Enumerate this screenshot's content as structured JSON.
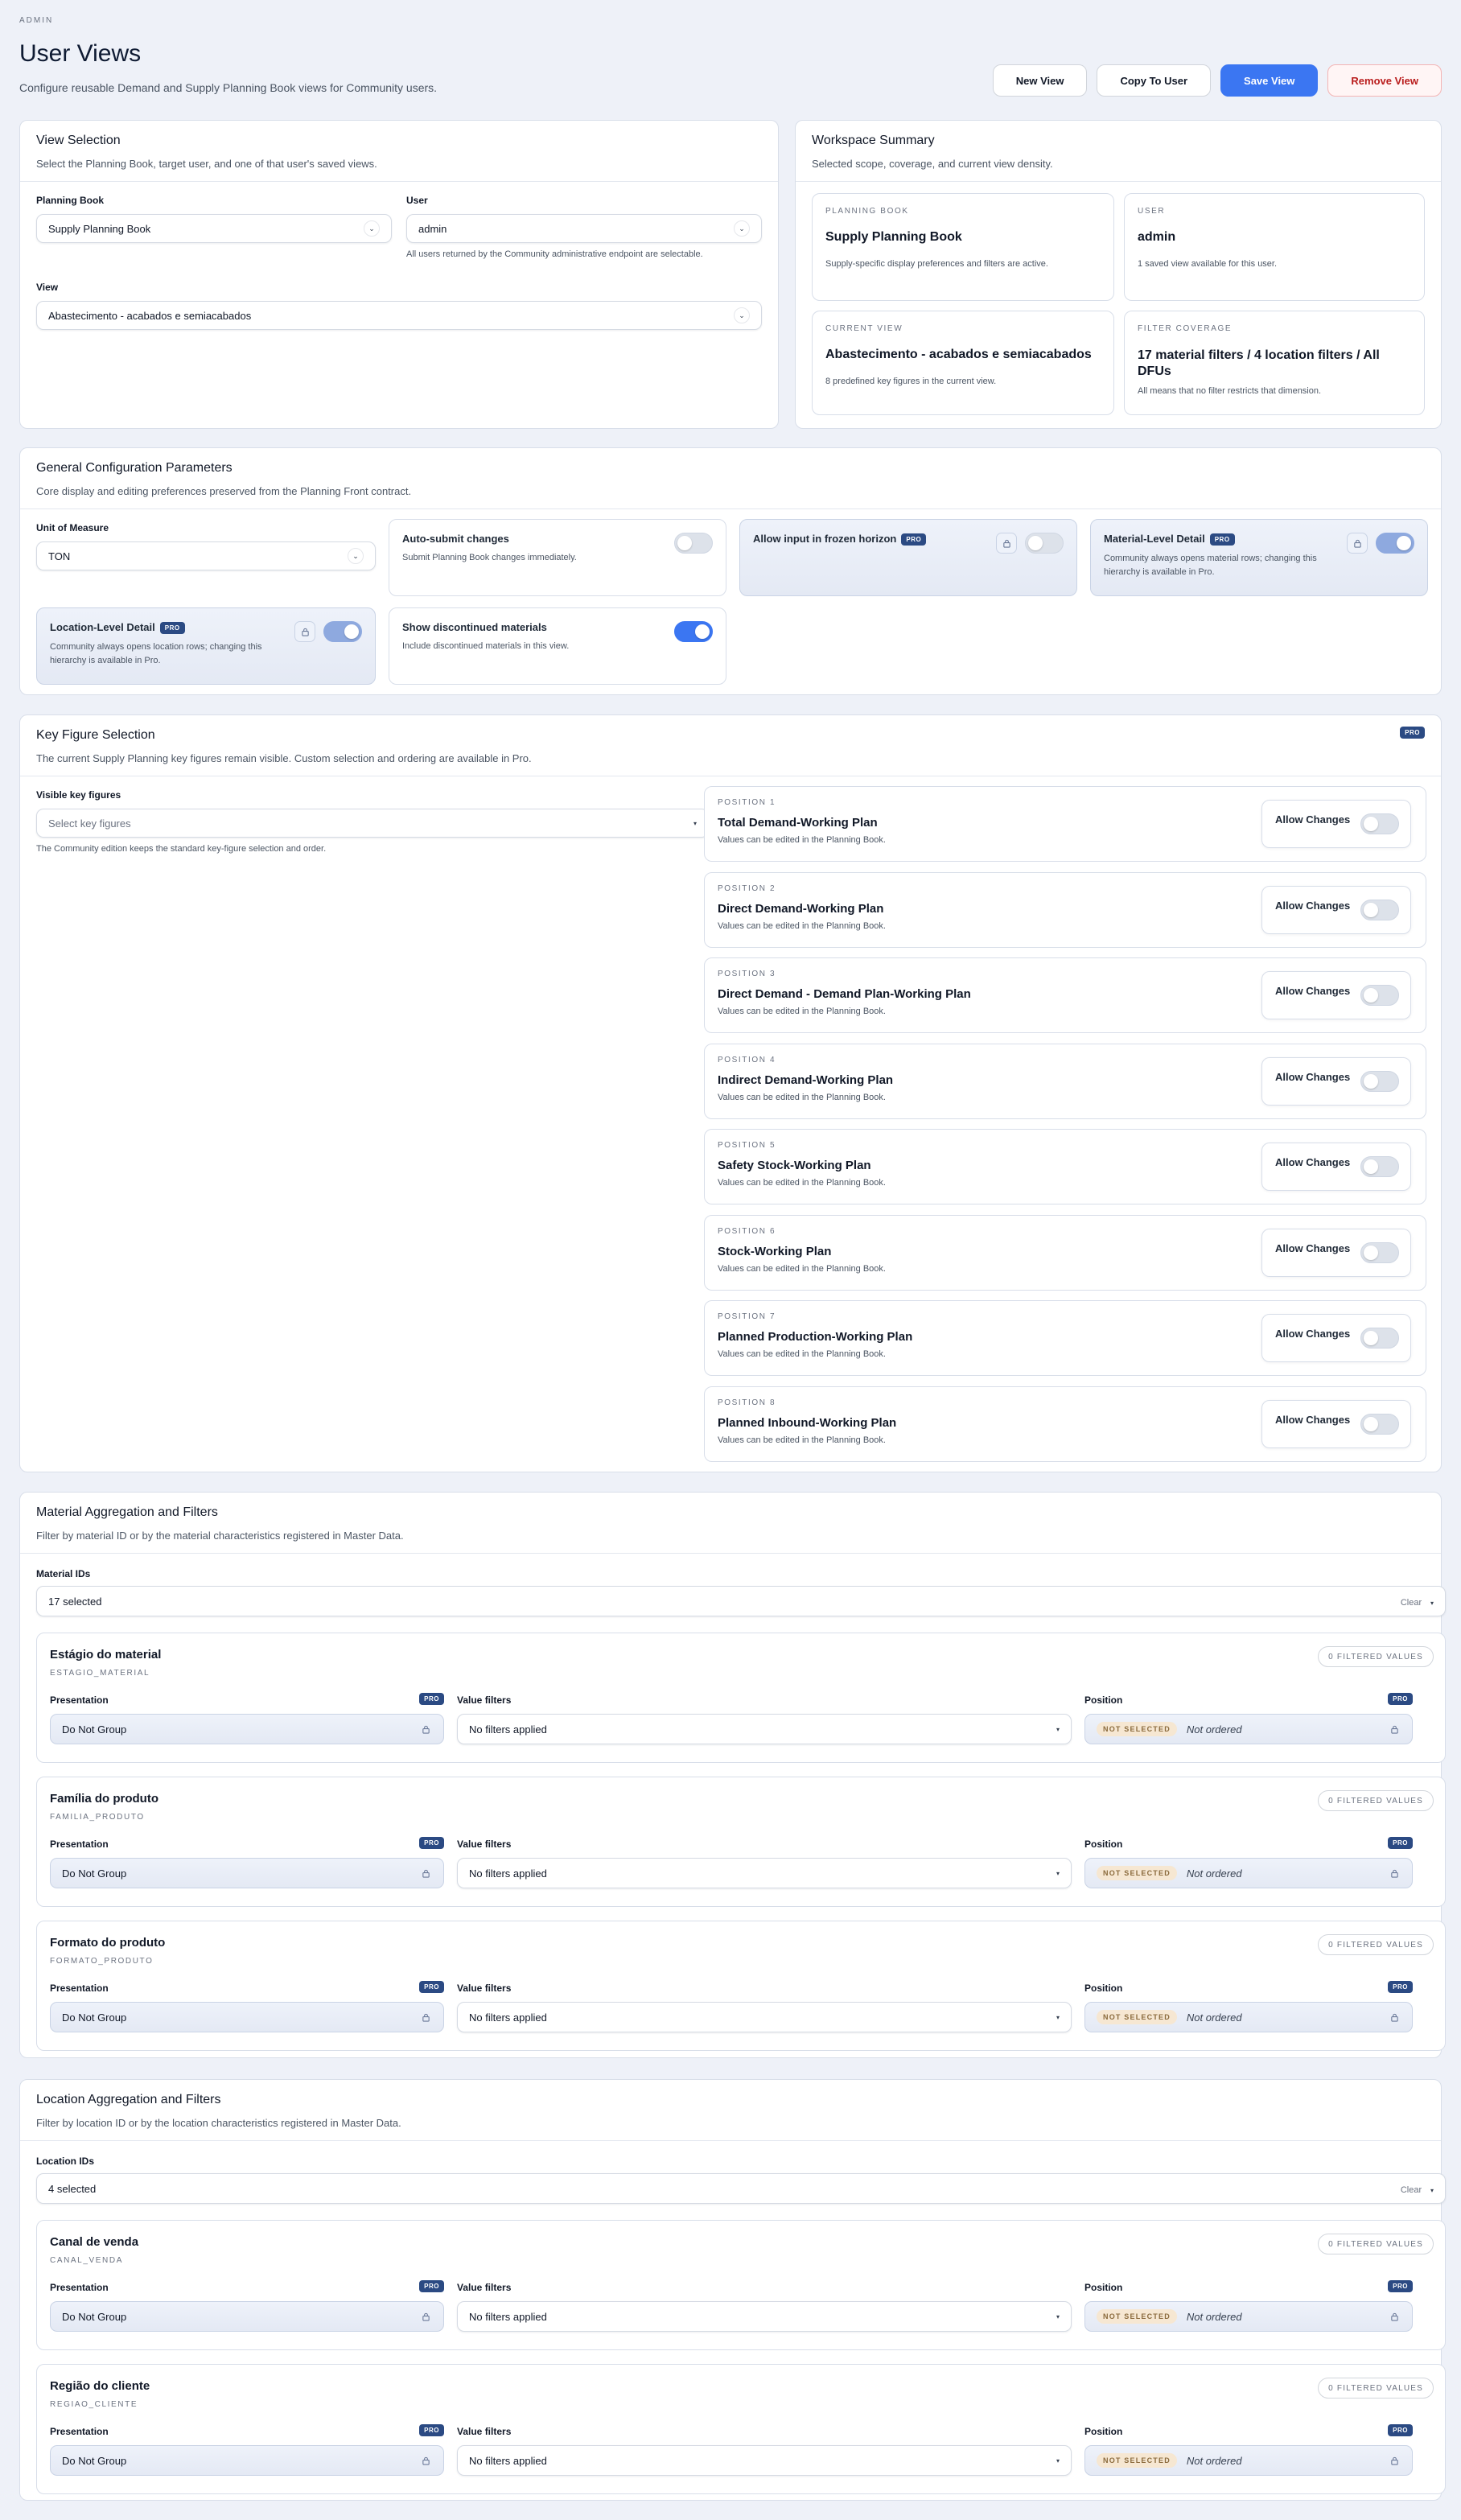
{
  "header": {
    "eyebrow": "ADMIN",
    "title": "User Views",
    "subtitle": "Configure reusable Demand and Supply Planning Book views for Community users.",
    "actions": {
      "new": "New View",
      "copy": "Copy To User",
      "save": "Save View",
      "remove": "Remove View"
    }
  },
  "view_selection": {
    "title": "View Selection",
    "subtitle": "Select the Planning Book, target user, and one of that user's saved views.",
    "planning_book_label": "Planning Book",
    "planning_book_value": "Supply Planning Book",
    "user_label": "User",
    "user_value": "admin",
    "user_hint": "All users returned by the Community administrative endpoint are selectable.",
    "view_label": "View",
    "view_value": "Abastecimento - acabados e semiacabados"
  },
  "workspace": {
    "title": "Workspace Summary",
    "subtitle": "Selected scope, coverage, and current view density.",
    "cards": [
      {
        "key": "PLANNING BOOK",
        "value": "Supply Planning Book",
        "desc": "Supply-specific display preferences and filters are active."
      },
      {
        "key": "USER",
        "value": "admin",
        "desc": "1 saved view available for this user."
      },
      {
        "key": "CURRENT VIEW",
        "value": "Abastecimento - acabados e semiacabados",
        "desc": "8 predefined key figures in the current view."
      },
      {
        "key": "FILTER COVERAGE",
        "value": "17 material filters / 4 location filters / All DFUs",
        "desc": "All means that no filter restricts that dimension."
      }
    ]
  },
  "general": {
    "title": "General Configuration Parameters",
    "subtitle": "Core display and editing preferences preserved from the Planning Front contract.",
    "uom_label": "Unit of Measure",
    "uom_value": "TON",
    "options": [
      {
        "title": "Auto-submit changes",
        "desc": "Submit Planning Book changes immediately.",
        "pro": false,
        "state": "off"
      },
      {
        "title": "Allow input in frozen horizon",
        "desc": "",
        "pro": true,
        "state": "off"
      },
      {
        "title": "Material-Level Detail",
        "desc": "Community always opens material rows; changing this hierarchy is available in Pro.",
        "pro": true,
        "state": "on"
      },
      {
        "title": "Location-Level Detail",
        "desc": "Community always opens location rows; changing this hierarchy is available in Pro.",
        "pro": true,
        "state": "on"
      },
      {
        "title": "Show discontinued materials",
        "desc": "Include discontinued materials in this view.",
        "pro": false,
        "state": "on"
      }
    ],
    "pro_label": "PRO"
  },
  "keyfig": {
    "title": "Key Figure Selection",
    "subtitle": "The current Supply Planning key figures remain visible. Custom selection and ordering are available in Pro.",
    "visible_label": "Visible key figures",
    "placeholder": "Select key figures",
    "hint": "The Community edition keeps the standard key-figure selection and order.",
    "allow_label": "Allow Changes",
    "edit_desc": "Values can be edited in the Planning Book.",
    "items": [
      {
        "pos": "POSITION 1",
        "name": "Total Demand-Working Plan"
      },
      {
        "pos": "POSITION 2",
        "name": "Direct Demand-Working Plan"
      },
      {
        "pos": "POSITION 3",
        "name": "Direct Demand - Demand Plan-Working Plan"
      },
      {
        "pos": "POSITION 4",
        "name": "Indirect Demand-Working Plan"
      },
      {
        "pos": "POSITION 5",
        "name": "Safety Stock-Working Plan"
      },
      {
        "pos": "POSITION 6",
        "name": "Stock-Working Plan"
      },
      {
        "pos": "POSITION 7",
        "name": "Planned Production-Working Plan"
      },
      {
        "pos": "POSITION 8",
        "name": "Planned Inbound-Working Plan"
      }
    ]
  },
  "common": {
    "presentation": "Presentation",
    "value_filters": "Value filters",
    "position": "Position",
    "do_not_group": "Do Not Group",
    "no_filters": "No filters applied",
    "not_selected": "NOT SELECTED",
    "not_ordered": "Not ordered",
    "filtered": "0 FILTERED VALUES",
    "clear": "Clear"
  },
  "material": {
    "title": "Material Aggregation and Filters",
    "subtitle": "Filter by material ID or by the material characteristics registered in Master Data.",
    "ids_label": "Material IDs",
    "ids_value": "17 selected",
    "attrs": [
      {
        "name": "Estágio do material",
        "code": "ESTAGIO_MATERIAL"
      },
      {
        "name": "Família do produto",
        "code": "FAMILIA_PRODUTO"
      },
      {
        "name": "Formato do produto",
        "code": "FORMATO_PRODUTO"
      }
    ]
  },
  "location": {
    "title": "Location Aggregation and Filters",
    "subtitle": "Filter by location ID or by the location characteristics registered in Master Data.",
    "ids_label": "Location IDs",
    "ids_value": "4 selected",
    "attrs": [
      {
        "name": "Canal de venda",
        "code": "CANAL_VENDA"
      },
      {
        "name": "Região do cliente",
        "code": "REGIAO_CLIENTE"
      }
    ]
  }
}
